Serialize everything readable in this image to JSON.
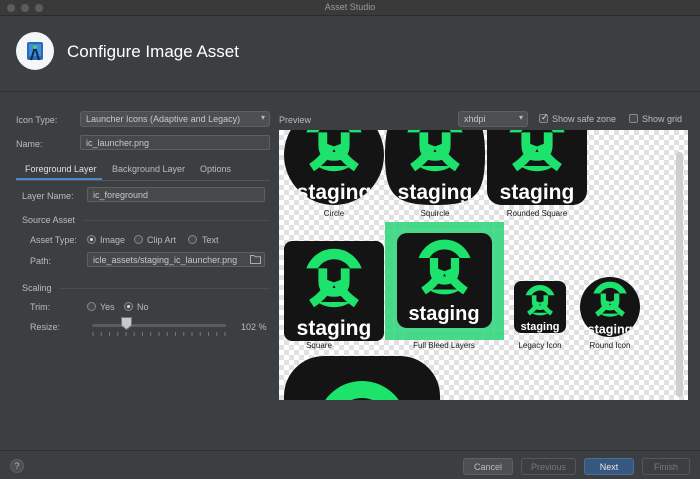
{
  "window": {
    "title": "Asset Studio"
  },
  "header": {
    "title": "Configure Image Asset"
  },
  "form": {
    "icon_type_label": "Icon Type:",
    "icon_type_value": "Launcher Icons (Adaptive and Legacy)",
    "name_label": "Name:",
    "name_value": "ic_launcher.png"
  },
  "tabs": [
    {
      "label": "Foreground Layer",
      "active": true
    },
    {
      "label": "Background Layer",
      "active": false
    },
    {
      "label": "Options",
      "active": false
    }
  ],
  "foreground": {
    "layer_name_label": "Layer Name:",
    "layer_name_value": "ic_foreground",
    "source_asset_heading": "Source Asset",
    "asset_type_label": "Asset Type:",
    "asset_type_options": [
      "Image",
      "Clip Art",
      "Text"
    ],
    "asset_type_selected": "Image",
    "path_label": "Path:",
    "path_value": "icle_assets/staging_ic_launcher.png",
    "scaling_heading": "Scaling",
    "trim_label": "Trim:",
    "trim_options": [
      "Yes",
      "No"
    ],
    "trim_selected": "No",
    "resize_label": "Resize:",
    "resize_value": "102 %",
    "resize_fraction": 0.26
  },
  "preview": {
    "label": "Preview",
    "density": "xhdpi",
    "show_safe_zone_label": "Show safe zone",
    "show_safe_zone_checked": true,
    "show_grid_label": "Show grid",
    "show_grid_checked": false,
    "icon_text": "staging",
    "items": [
      "Circle",
      "Squircle",
      "Rounded Square",
      "Square",
      "Full Bleed Layers",
      "Legacy Icon",
      "Round Icon"
    ]
  },
  "colors": {
    "accent": "#4a88c7",
    "brand_green": "#1de26b",
    "icon_bg": "#141414",
    "full_bleed_bg": "#47d98a"
  },
  "buttons": {
    "cancel": "Cancel",
    "previous": "Previous",
    "next": "Next",
    "finish": "Finish",
    "help": "?"
  }
}
